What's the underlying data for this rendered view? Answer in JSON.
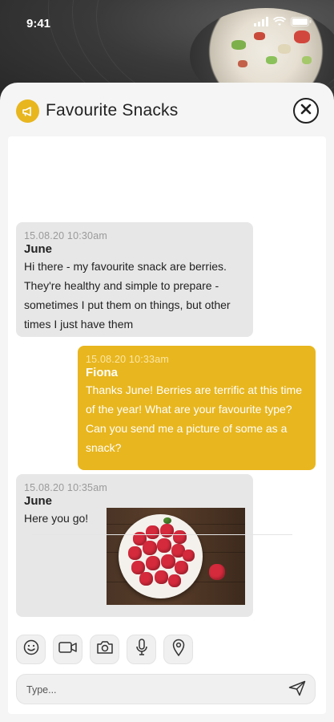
{
  "status": {
    "time": "9:41"
  },
  "header": {
    "title": "Favourite Snacks",
    "accent": "#e8b61e",
    "badge_icon": "megaphone-icon",
    "close_icon": "close-circle-icon"
  },
  "messages": [
    {
      "direction": "incoming",
      "timestamp": "15.08.20 10:30am",
      "sender": "June",
      "text": "Hi there - my favourite snack are berries.  They're healthy and simple to prepare - sometimes I put them on things, but other times I just have them"
    },
    {
      "direction": "outgoing",
      "timestamp": "15.08.20 10:33am",
      "sender": "Fiona",
      "text": "Thanks June! Berries are terrific at this time of the year!  What are your favourite type? Can you send me a picture of some as a snack?"
    },
    {
      "direction": "incoming",
      "timestamp": "15.08.20 10:35am",
      "sender": "June",
      "text": "Here you go!",
      "attachment": "raspberries-bowl-photo"
    }
  ],
  "toolbar": {
    "items": [
      {
        "icon": "smiley-icon"
      },
      {
        "icon": "video-camera-icon"
      },
      {
        "icon": "camera-icon"
      },
      {
        "icon": "microphone-icon"
      },
      {
        "icon": "location-pin-icon"
      }
    ]
  },
  "composer": {
    "placeholder": "Type...",
    "value": "",
    "send_icon": "send-icon"
  }
}
